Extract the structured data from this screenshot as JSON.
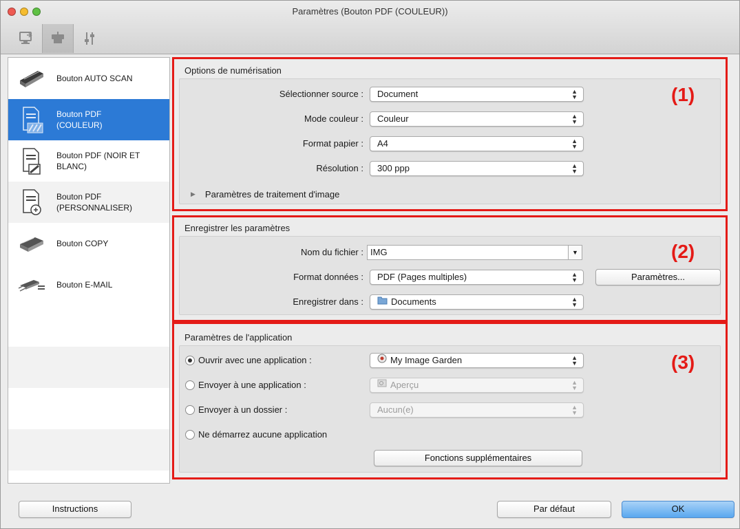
{
  "window": {
    "title": "Paramètres (Bouton PDF (COULEUR))"
  },
  "toolbar_tabs": [
    {
      "icon": "scan-from-computer-icon"
    },
    {
      "icon": "scan-from-panel-icon"
    },
    {
      "icon": "general-settings-icon"
    }
  ],
  "sidebar": {
    "items": [
      {
        "label": "Bouton AUTO SCAN",
        "icon": "auto-scan-icon"
      },
      {
        "label": "Bouton PDF\n(COULEUR)",
        "icon": "pdf-color-icon"
      },
      {
        "label": "Bouton PDF (NOIR ET\nBLANC)",
        "icon": "pdf-bw-icon"
      },
      {
        "label": "Bouton PDF\n(PERSONNALISER)",
        "icon": "pdf-custom-icon"
      },
      {
        "label": "Bouton COPY",
        "icon": "copy-icon"
      },
      {
        "label": "Bouton E-MAIL",
        "icon": "email-icon"
      }
    ],
    "selected_index": 1
  },
  "scan_options": {
    "title": "Options de numérisation",
    "marker": "(1)",
    "source_label": "Sélectionner source :",
    "source_value": "Document",
    "color_mode_label": "Mode couleur :",
    "color_mode_value": "Couleur",
    "paper_size_label": "Format papier :",
    "paper_size_value": "A4",
    "resolution_label": "Résolution :",
    "resolution_value": "300 ppp",
    "image_processing_label": "Paramètres de traitement d'image"
  },
  "save_settings": {
    "title": "Enregistrer les paramètres",
    "marker": "(2)",
    "file_name_label": "Nom du fichier :",
    "file_name_value": "IMG",
    "data_format_label": "Format données :",
    "data_format_value": "PDF (Pages multiples)",
    "settings_button": "Paramètres...",
    "save_in_label": "Enregistrer dans :",
    "save_in_value": "Documents"
  },
  "app_settings": {
    "title": "Paramètres de l'application",
    "marker": "(3)",
    "open_with_label": "Ouvrir avec une application :",
    "open_with_value": "My Image Garden",
    "send_to_app_label": "Envoyer à une application :",
    "send_to_app_value": "Aperçu",
    "send_to_folder_label": "Envoyer à un dossier :",
    "send_to_folder_value": "Aucun(e)",
    "no_app_label": "Ne démarrez aucune application",
    "selected_option": "open_with",
    "more_functions_button": "Fonctions supplémentaires"
  },
  "footer": {
    "instructions_button": "Instructions",
    "defaults_button": "Par défaut",
    "ok_button": "OK"
  },
  "colors": {
    "highlight_border": "#e41b17",
    "selection_blue": "#2c7ad6"
  }
}
